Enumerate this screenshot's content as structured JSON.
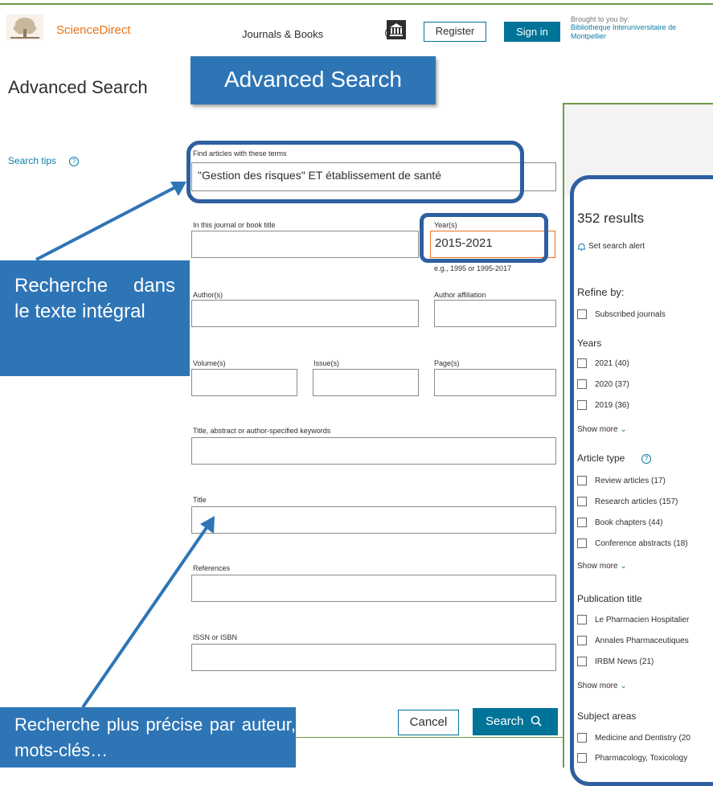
{
  "header": {
    "brand": "ScienceDirect",
    "nav_journals": "Journals & Books",
    "register": "Register",
    "sign_in": "Sign in",
    "brought_by": "Brought to you by:",
    "institution": "Bibliotheque Interuniversitaire de Montpellier"
  },
  "page": {
    "title": "Advanced Search",
    "search_tips": "Search tips"
  },
  "callouts": {
    "advanced": "Advanced Search",
    "fulltext": "Recherche dans le texte intégral",
    "precise": "Recherche plus précise par auteur, mots-clés…"
  },
  "form": {
    "terms_label": "Find articles with these terms",
    "terms_value": "\"Gestion des risques\" ET établissement de santé",
    "journal_label": "In this journal or book title",
    "journal_value": "",
    "years_label": "Year(s)",
    "years_value": "2015-2021",
    "years_hint": "e.g., 1995 or 1995-2017",
    "author_label": "Author(s)",
    "affiliation_label": "Author affiliation",
    "volume_label": "Volume(s)",
    "issue_label": "Issue(s)",
    "page_label": "Page(s)",
    "keywords_label": "Title, abstract or author-specified keywords",
    "title_label": "Title",
    "references_label": "References",
    "issn_label": "ISSN or ISBN",
    "cancel": "Cancel",
    "search": "Search"
  },
  "results": {
    "count": "352 results",
    "set_alert": "Set search alert",
    "refine_by": "Refine by:",
    "subscribed": "Subscribed journals",
    "years_title": "Years",
    "years": [
      "2021 (40)",
      "2020 (37)",
      "2019 (36)"
    ],
    "show_more": "Show more",
    "article_type_title": "Article type",
    "article_types": [
      "Review articles (17)",
      "Research articles (157)",
      "Book chapters (44)",
      "Conference abstracts (18)"
    ],
    "publication_title": "Publication title",
    "publications": [
      "Le Pharmacien Hospitalier",
      "Annales Pharmaceutiques",
      "IRBM News (21)"
    ],
    "subject_title": "Subject areas",
    "subjects": [
      "Medicine and Dentistry (20",
      "Pharmacology, Toxicology"
    ]
  },
  "colors": {
    "brand_orange": "#e9711c",
    "primary_teal": "#007398",
    "callout_blue": "#2e75b6",
    "highlight_border": "#2e5f9f",
    "frame_green": "#6d9a46"
  }
}
